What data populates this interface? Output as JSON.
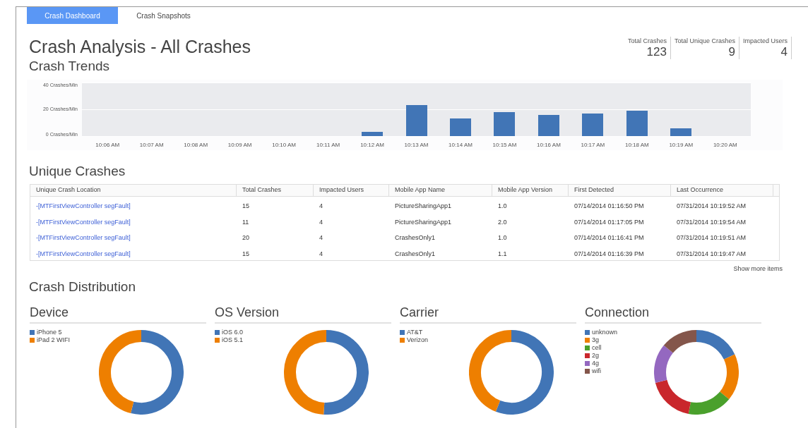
{
  "tabs": [
    {
      "label": "Crash Dashboard",
      "selected": true
    },
    {
      "label": "Crash Snapshots",
      "selected": false
    }
  ],
  "title": "Crash Analysis - All Crashes",
  "stats": [
    {
      "label": "Total Crashes",
      "value": "123"
    },
    {
      "label": "Total Unique Crashes",
      "value": "9"
    },
    {
      "label": "Impacted Users",
      "value": "4"
    }
  ],
  "trends": {
    "heading": "Crash Trends",
    "chart_data": {
      "type": "bar",
      "categories": [
        "10:06 AM",
        "10:07 AM",
        "10:08 AM",
        "10:09 AM",
        "10:10 AM",
        "10:11 AM",
        "10:12 AM",
        "10:13 AM",
        "10:14 AM",
        "10:15 AM",
        "10:16 AM",
        "10:17 AM",
        "10:18 AM",
        "10:19 AM",
        "10:20 AM"
      ],
      "values": [
        0,
        0,
        0,
        0,
        0,
        0,
        3,
        23,
        13,
        18,
        16,
        17,
        19,
        6,
        0
      ],
      "ylim": [
        0,
        40
      ],
      "yticks": [
        {
          "value": 0,
          "label": "0 Crashes/Min"
        },
        {
          "value": 20,
          "label": "20 Crashes/Min"
        },
        {
          "value": 40,
          "label": "40 Crashes/Min"
        }
      ]
    }
  },
  "unique": {
    "heading": "Unique Crashes",
    "columns": [
      "Unique Crash Location",
      "Total Crashes",
      "Impacted Users",
      "Mobile App Name",
      "Mobile App Version",
      "First Detected",
      "Last Occurrence"
    ],
    "rows": [
      [
        "-[MTFirstViewController segFault]",
        "15",
        "4",
        "PictureSharingApp1",
        "1.0",
        "07/14/2014 01:16:50 PM",
        "07/31/2014 10:19:52 AM"
      ],
      [
        "-[MTFirstViewController segFault]",
        "11",
        "4",
        "PictureSharingApp1",
        "2.0",
        "07/14/2014 01:17:05 PM",
        "07/31/2014 10:19:54 AM"
      ],
      [
        "-[MTFirstViewController segFault]",
        "20",
        "4",
        "CrashesOnly1",
        "1.0",
        "07/14/2014 01:16:41 PM",
        "07/31/2014 10:19:51 AM"
      ],
      [
        "-[MTFirstViewController segFault]",
        "15",
        "4",
        "CrashesOnly1",
        "1.1",
        "07/14/2014 01:16:39 PM",
        "07/31/2014 10:19:47 AM"
      ]
    ],
    "more": "Show more items"
  },
  "distribution": {
    "heading": "Crash Distribution",
    "panels": [
      {
        "title": "Device",
        "legend": [
          {
            "label": "iPhone 5",
            "color": "#4175b6"
          },
          {
            "label": "iPad 2 WIFI",
            "color": "#ee7f00"
          }
        ]
      },
      {
        "title": "OS Version",
        "legend": [
          {
            "label": "iOS 6.0",
            "color": "#4175b6"
          },
          {
            "label": "iOS 5.1",
            "color": "#ee7f00"
          }
        ]
      },
      {
        "title": "Carrier",
        "legend": [
          {
            "label": "AT&T",
            "color": "#4175b6"
          },
          {
            "label": "Verizon",
            "color": "#ee7f00"
          }
        ]
      },
      {
        "title": "Connection",
        "legend": [
          {
            "label": "unknown",
            "color": "#4175b6"
          },
          {
            "label": "3g",
            "color": "#ee7f00"
          },
          {
            "label": "cell",
            "color": "#4aa02c"
          },
          {
            "label": "2g",
            "color": "#c9272c"
          },
          {
            "label": "4g",
            "color": "#9468c0"
          },
          {
            "label": "wifi",
            "color": "#84564b"
          }
        ]
      }
    ]
  }
}
